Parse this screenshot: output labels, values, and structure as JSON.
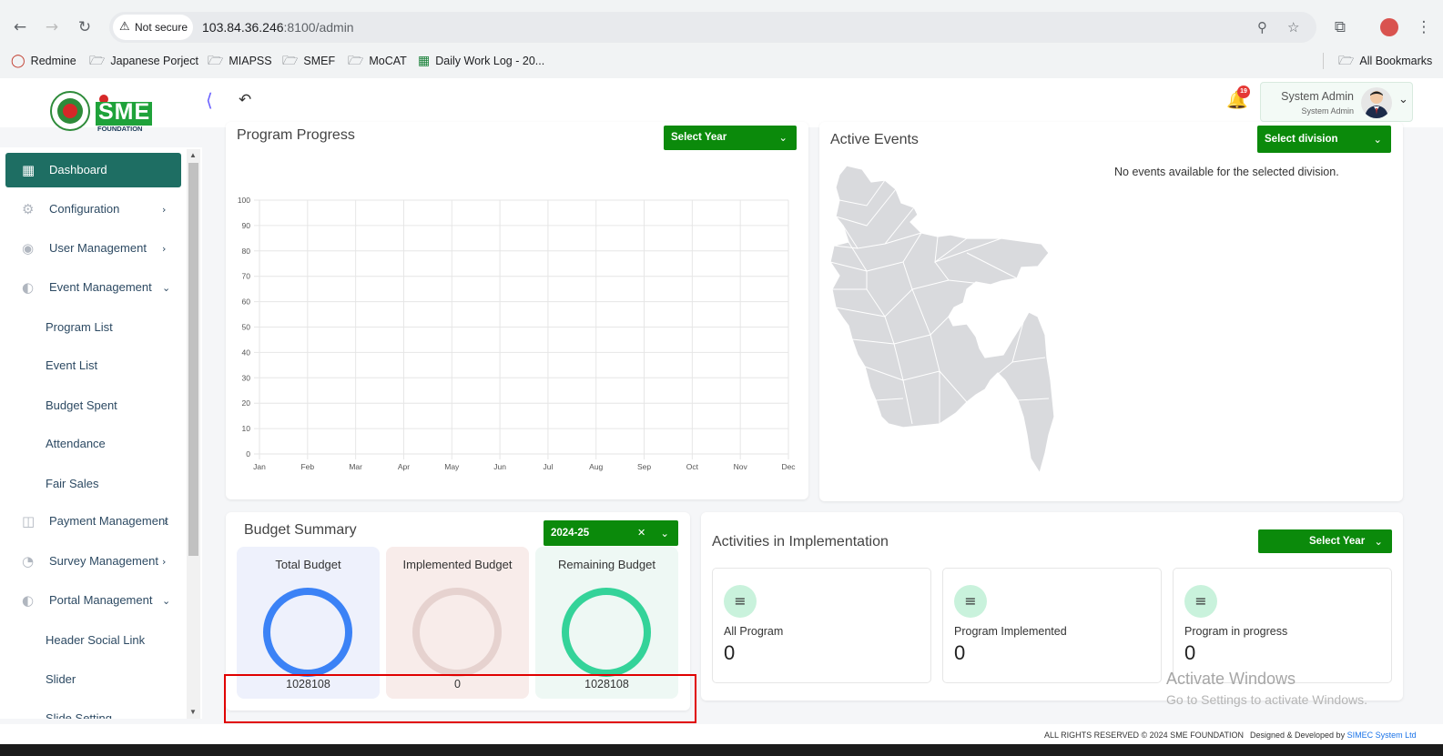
{
  "browser": {
    "security_label": "Not secure",
    "url_host": "103.84.36.246",
    "url_rest": ":8100/admin",
    "bookmarks": [
      "Redmine",
      "Japanese Porject",
      "MIAPSS",
      "SMEF",
      "MoCAT",
      "Daily Work Log - 20...",
      "All Bookmarks"
    ]
  },
  "header": {
    "logo_text": "SME",
    "logo_sub": "FOUNDATION",
    "notification_count": "19",
    "user_name": "System Admin",
    "user_role": "System Admin"
  },
  "sidebar": {
    "items": [
      {
        "label": "Dashboard",
        "icon": "grid-icon"
      },
      {
        "label": "Configuration",
        "icon": "config-icon"
      },
      {
        "label": "User Management",
        "icon": "user-icon"
      },
      {
        "label": "Event Management",
        "icon": "event-icon"
      },
      {
        "label": "Program List"
      },
      {
        "label": "Event List"
      },
      {
        "label": "Budget Spent"
      },
      {
        "label": "Attendance"
      },
      {
        "label": "Fair Sales"
      },
      {
        "label": "Payment Management",
        "icon": "payment-icon"
      },
      {
        "label": "Survey Management",
        "icon": "survey-icon"
      },
      {
        "label": "Portal Management",
        "icon": "portal-icon"
      },
      {
        "label": "Header Social Link"
      },
      {
        "label": "Slider"
      },
      {
        "label": "Slide Setting"
      }
    ]
  },
  "program_progress": {
    "title": "Program Progress",
    "select_label": "Select Year"
  },
  "chart_data": {
    "type": "line",
    "title": "Program Progress",
    "categories": [
      "Jan",
      "Feb",
      "Mar",
      "Apr",
      "May",
      "Jun",
      "Jul",
      "Aug",
      "Sep",
      "Oct",
      "Nov",
      "Dec"
    ],
    "series": [],
    "ylim": [
      0,
      100
    ],
    "yticks": [
      0,
      10,
      20,
      30,
      40,
      50,
      60,
      70,
      80,
      90,
      100
    ],
    "grid": true
  },
  "active_events": {
    "title": "Active Events",
    "select_label": "Select division",
    "empty_message": "No events available for the selected division."
  },
  "budget_summary": {
    "title": "Budget Summary",
    "year": "2024-25",
    "clear_symbol": "✕",
    "boxes": [
      {
        "label": "Total Budget",
        "value": "1028108",
        "ring_color": "#3b82f6",
        "bg": "#eef1fc"
      },
      {
        "label": "Implemented Budget",
        "value": "0",
        "ring_color": "#e6d2cf",
        "bg": "#f8ecea"
      },
      {
        "label": "Remaining Budget",
        "value": "1028108",
        "ring_color": "#34d399",
        "bg": "#eef8f4"
      }
    ]
  },
  "activities": {
    "title": "Activities in Implementation",
    "select_label": "Select Year",
    "boxes": [
      {
        "label": "All Program",
        "count": "0"
      },
      {
        "label": "Program Implemented",
        "count": "0"
      },
      {
        "label": "Program in progress",
        "count": "0"
      }
    ]
  },
  "watermark": {
    "line1": "Activate Windows",
    "line2": "Go to Settings to activate Windows."
  },
  "footer": {
    "copyright": "ALL RIGHTS RESERVED © 2024 SME FOUNDATION",
    "designed": "Designed & Developed by",
    "developer": "SIMEC System Ltd"
  }
}
